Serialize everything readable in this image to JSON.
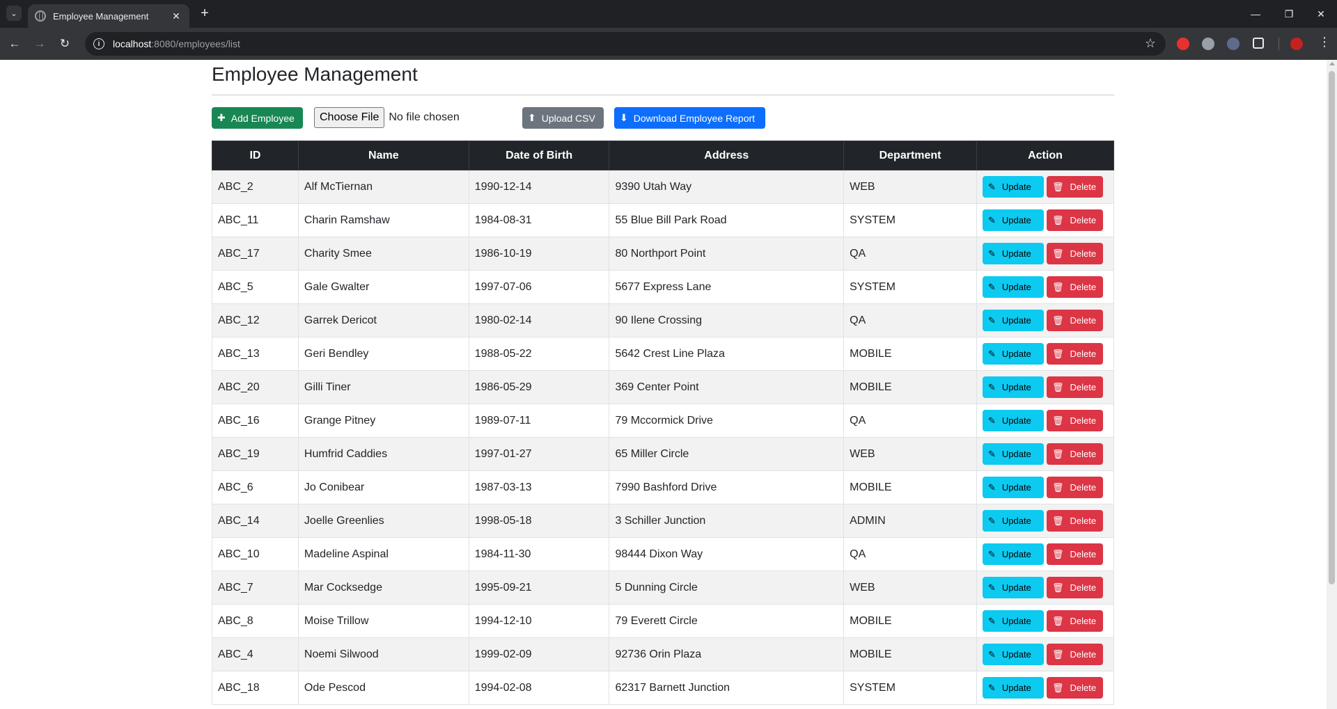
{
  "browser": {
    "tab_title": "Employee Management",
    "url_host": "localhost",
    "url_path": ":8080/employees/list"
  },
  "page": {
    "title": "Employee Management",
    "toolbar": {
      "add_label": "Add Employee",
      "choose_file_label": "Choose File",
      "no_file_text": "No file chosen",
      "upload_label": "Upload CSV",
      "download_label": "Download Employee Report"
    },
    "table": {
      "headers": [
        "ID",
        "Name",
        "Date of Birth",
        "Address",
        "Department",
        "Action"
      ],
      "update_label": "Update",
      "delete_label": "Delete",
      "rows": [
        {
          "id": "ABC_2",
          "name": "Alf McTiernan",
          "dob": "1990-12-14",
          "address": "9390 Utah Way",
          "dept": "WEB"
        },
        {
          "id": "ABC_11",
          "name": "Charin Ramshaw",
          "dob": "1984-08-31",
          "address": "55 Blue Bill Park Road",
          "dept": "SYSTEM"
        },
        {
          "id": "ABC_17",
          "name": "Charity Smee",
          "dob": "1986-10-19",
          "address": "80 Northport Point",
          "dept": "QA"
        },
        {
          "id": "ABC_5",
          "name": "Gale Gwalter",
          "dob": "1997-07-06",
          "address": "5677 Express Lane",
          "dept": "SYSTEM"
        },
        {
          "id": "ABC_12",
          "name": "Garrek Dericot",
          "dob": "1980-02-14",
          "address": "90 Ilene Crossing",
          "dept": "QA"
        },
        {
          "id": "ABC_13",
          "name": "Geri Bendley",
          "dob": "1988-05-22",
          "address": "5642 Crest Line Plaza",
          "dept": "MOBILE"
        },
        {
          "id": "ABC_20",
          "name": "Gilli Tiner",
          "dob": "1986-05-29",
          "address": "369 Center Point",
          "dept": "MOBILE"
        },
        {
          "id": "ABC_16",
          "name": "Grange Pitney",
          "dob": "1989-07-11",
          "address": "79 Mccormick Drive",
          "dept": "QA"
        },
        {
          "id": "ABC_19",
          "name": "Humfrid Caddies",
          "dob": "1997-01-27",
          "address": "65 Miller Circle",
          "dept": "WEB"
        },
        {
          "id": "ABC_6",
          "name": "Jo Conibear",
          "dob": "1987-03-13",
          "address": "7990 Bashford Drive",
          "dept": "MOBILE"
        },
        {
          "id": "ABC_14",
          "name": "Joelle Greenlies",
          "dob": "1998-05-18",
          "address": "3 Schiller Junction",
          "dept": "ADMIN"
        },
        {
          "id": "ABC_10",
          "name": "Madeline Aspinal",
          "dob": "1984-11-30",
          "address": "98444 Dixon Way",
          "dept": "QA"
        },
        {
          "id": "ABC_7",
          "name": "Mar Cocksedge",
          "dob": "1995-09-21",
          "address": "5 Dunning Circle",
          "dept": "WEB"
        },
        {
          "id": "ABC_8",
          "name": "Moise Trillow",
          "dob": "1994-12-10",
          "address": "79 Everett Circle",
          "dept": "MOBILE"
        },
        {
          "id": "ABC_4",
          "name": "Noemi Silwood",
          "dob": "1999-02-09",
          "address": "92736 Orin Plaza",
          "dept": "MOBILE"
        },
        {
          "id": "ABC_18",
          "name": "Ode Pescod",
          "dob": "1994-02-08",
          "address": "62317 Barnett Junction",
          "dept": "SYSTEM"
        }
      ]
    }
  },
  "icons": {
    "add": "plus-icon",
    "upload": "upload-icon",
    "download": "download-icon",
    "update": "pencil-icon",
    "delete": "trash-icon"
  },
  "colors": {
    "success": "#198754",
    "secondary": "#6c757d",
    "primary": "#0d6efd",
    "info": "#0dcaf0",
    "danger": "#dc3545",
    "dark": "#212529"
  }
}
